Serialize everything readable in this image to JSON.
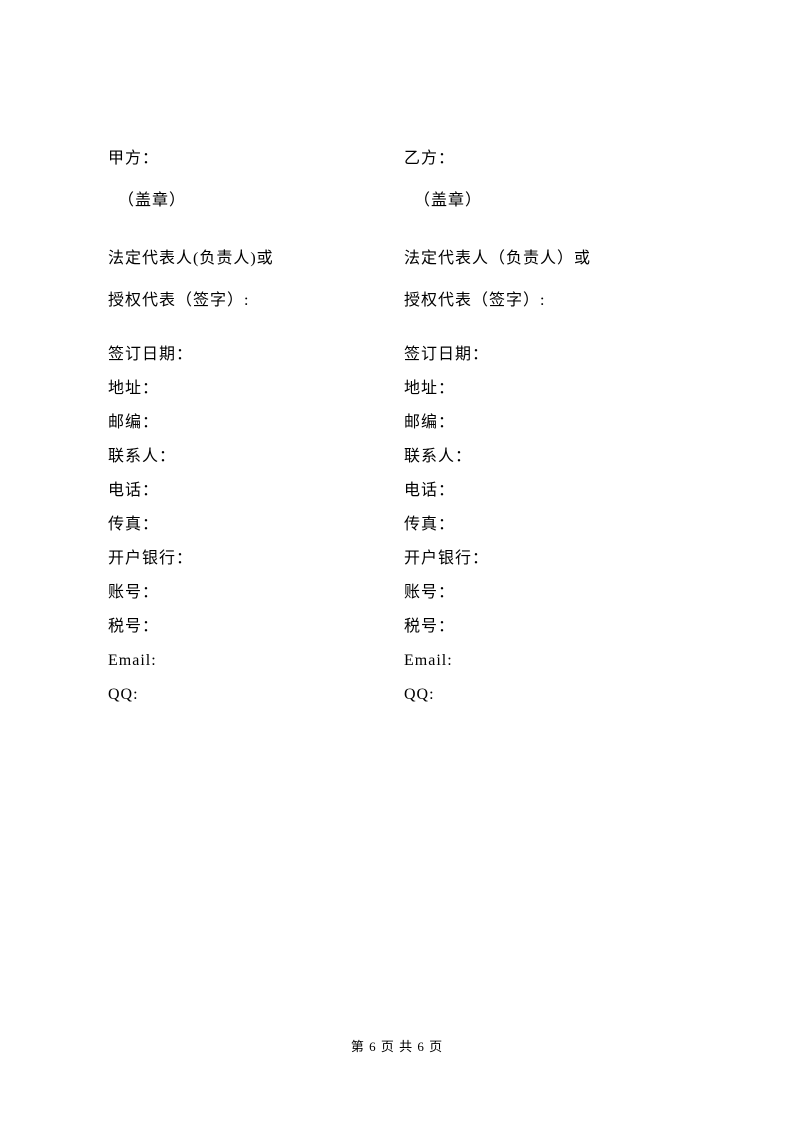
{
  "left": {
    "party": "甲方：",
    "seal": "（盖章）",
    "rep_line1": "法定代表人(负责人)或",
    "rep_line2": "授权代表（签字）:",
    "sign_date": "签订日期：",
    "address": "地址：",
    "postcode": "邮编：",
    "contact": "联系人：",
    "phone": "电话：",
    "fax": "传真：",
    "bank": "开户银行：",
    "account": "账号：",
    "tax": "税号：",
    "email": "Email:",
    "qq": "QQ:"
  },
  "right": {
    "party": "乙方：",
    "seal": "（盖章）",
    "rep_line1": "法定代表人（负责人）或",
    "rep_line2": "授权代表（签字）:",
    "sign_date": "签订日期：",
    "address": "地址：",
    "postcode": "邮编：",
    "contact": "联系人：",
    "phone": "电话：",
    "fax": "传真：",
    "bank": "开户银行：",
    "account": "账号：",
    "tax": "税号：",
    "email": "Email:",
    "qq": "QQ:"
  },
  "footer": "第 6 页  共 6 页"
}
